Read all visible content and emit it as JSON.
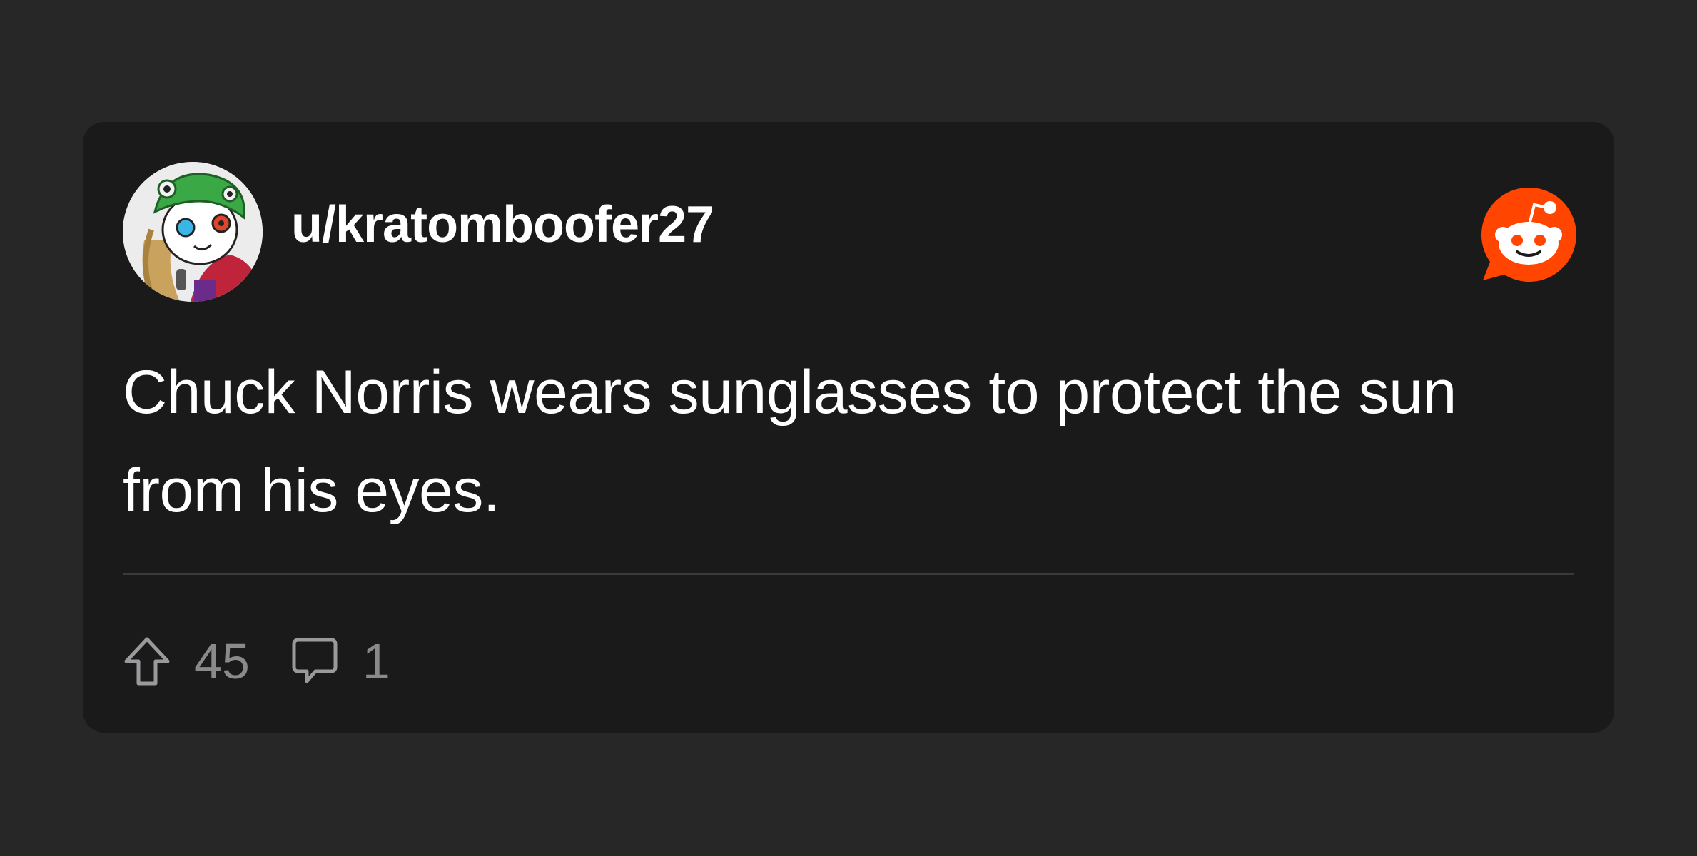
{
  "post": {
    "username": "u/kratomboofer27",
    "body": "Chuck Norris wears sunglasses to protect the sun from his eyes.",
    "upvotes": "45",
    "comments": "1"
  },
  "icons": {
    "avatar": "user-avatar",
    "brand": "reddit-logo-icon",
    "upvote": "upvote-arrow-icon",
    "comment": "comment-bubble-icon"
  },
  "colors": {
    "page_background": "#272727",
    "card_background": "#1a1a1b",
    "text_primary": "#ffffff",
    "text_muted": "#8a8a8c",
    "divider": "#3a3a3c",
    "reddit_orange": "#ff4500"
  }
}
